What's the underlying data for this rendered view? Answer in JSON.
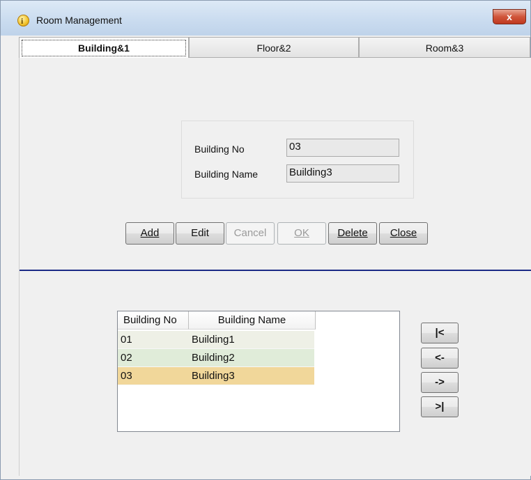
{
  "window": {
    "title": "Room Management",
    "close_glyph": "x"
  },
  "tabs": [
    {
      "label": "Building&1"
    },
    {
      "label": "Floor&2"
    },
    {
      "label": "Room&3"
    }
  ],
  "form": {
    "building_no_label": "Building No",
    "building_no_value": "03",
    "building_name_label": "Building Name",
    "building_name_value": "Building3"
  },
  "buttons": {
    "add": "Add",
    "edit": "Edit",
    "cancel": "Cancel",
    "ok": "OK",
    "delete": "Delete",
    "close": "Close"
  },
  "list": {
    "columns": [
      "Building No",
      "Building Name"
    ],
    "rows": [
      {
        "no": "01",
        "name": "Building1"
      },
      {
        "no": "02",
        "name": "Building2"
      },
      {
        "no": "03",
        "name": "Building3",
        "selected": true
      }
    ],
    "row_colors": [
      "#eef0e6",
      "#e0ecd9",
      "#f1d79a"
    ]
  },
  "navigation": {
    "first": "|<",
    "prev": "<-",
    "next": "->",
    "last": ">|"
  },
  "icons": {
    "title": "info-icon"
  }
}
